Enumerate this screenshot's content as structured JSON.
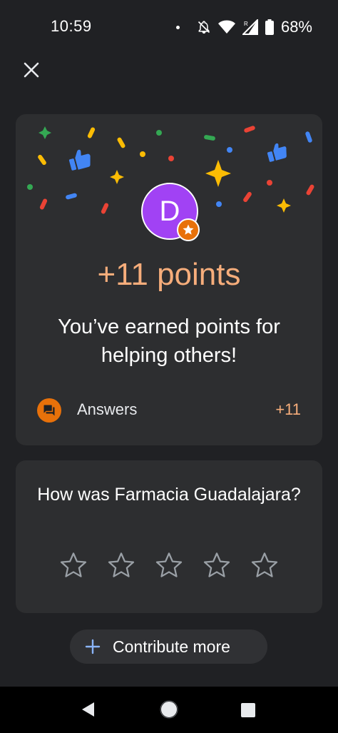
{
  "status_bar": {
    "time": "10:59",
    "battery": "68%",
    "icons": [
      "dot-icon",
      "notifications-off-icon",
      "wifi-icon",
      "signal-icon",
      "battery-icon"
    ]
  },
  "header": {
    "close_icon": "close-icon"
  },
  "points_card": {
    "avatar_letter": "D",
    "avatar_color": "#a142f4",
    "badge_icon": "star-icon",
    "title": "+11 points",
    "message": "You’ve earned points for helping others!",
    "activity": {
      "icon": "forum-icon",
      "label": "Answers",
      "points": "+11"
    },
    "accent_color": "#f6ad7b"
  },
  "rating_card": {
    "question": "How was Farmacia Guadalajara?",
    "star_count": 5,
    "selected": 0
  },
  "contribute": {
    "label": "Contribute more",
    "icon": "plus-icon"
  },
  "nav": {
    "back_icon": "back-icon",
    "home_icon": "home-icon",
    "recents_icon": "recents-icon"
  }
}
